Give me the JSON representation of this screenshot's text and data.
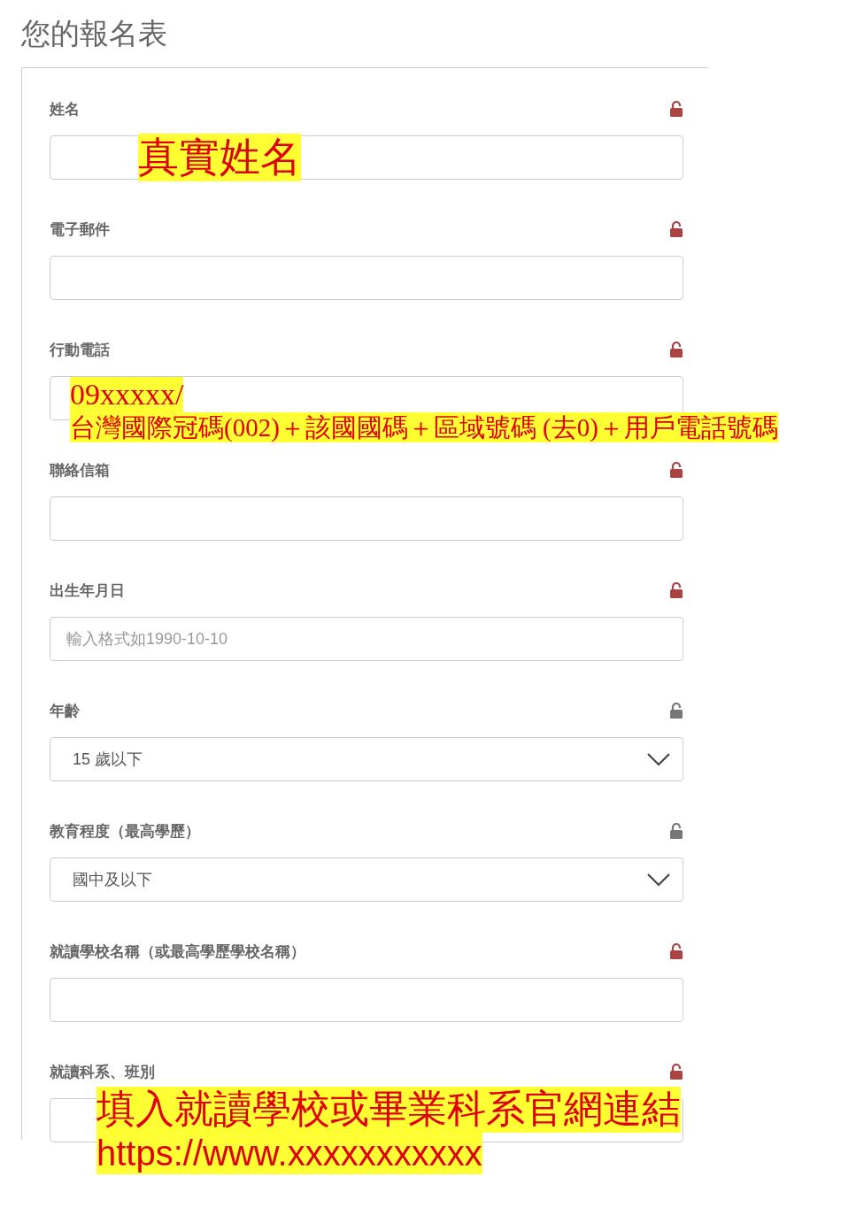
{
  "title": "您的報名表",
  "fields": [
    {
      "label": "姓名",
      "kind": "text",
      "color": "#a94442",
      "annotation": [
        "真實姓名"
      ]
    },
    {
      "label": "電子郵件",
      "kind": "text",
      "color": "#a94442"
    },
    {
      "label": "行動電話",
      "kind": "text",
      "color": "#a94442",
      "annotation": [
        "09xxxxx/",
        "台灣國際冠碼(002)＋該國國碼＋區域號碼 (去0)＋用戶電話號碼"
      ]
    },
    {
      "label": "聯絡信箱",
      "kind": "text",
      "color": "#a94442"
    },
    {
      "label": "出生年月日",
      "kind": "text",
      "color": "#a94442",
      "placeholder": "輸入格式如1990-10-10"
    },
    {
      "label": "年齡",
      "kind": "select",
      "color": "#777777",
      "value": "15 歲以下"
    },
    {
      "label": "教育程度（最高學歷）",
      "kind": "select",
      "color": "#777777",
      "value": "國中及以下"
    },
    {
      "label": "就讀學校名稱（或最高學歷學校名稱）",
      "kind": "text",
      "color": "#a94442"
    },
    {
      "label": "就讀科系、班別",
      "kind": "text",
      "color": "#a94442",
      "annotation": [
        "填入就讀學校或畢業科系官網連結",
        "https://www.xxxxxxxxxxx"
      ]
    }
  ]
}
